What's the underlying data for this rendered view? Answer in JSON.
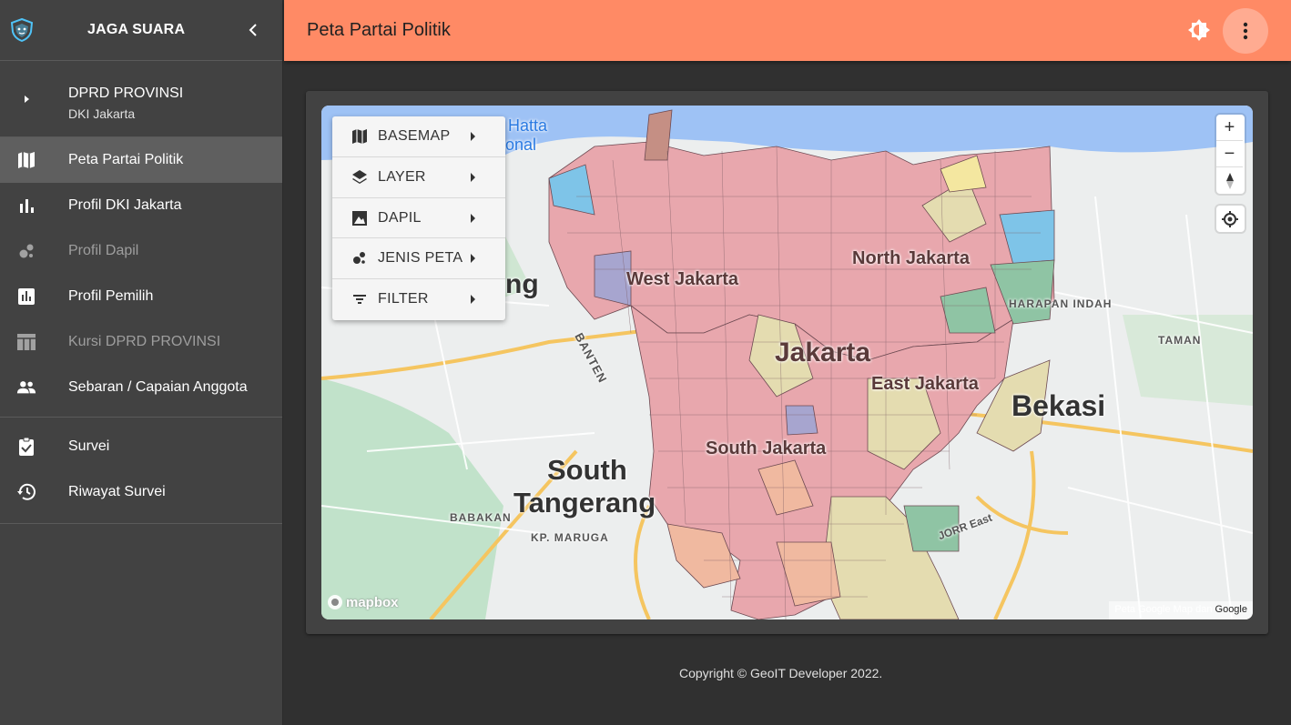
{
  "sidebar": {
    "brand": "JAGA SUARA",
    "section": {
      "title": "DPRD PROVINSI",
      "subtitle": "DKI Jakarta"
    },
    "items": [
      {
        "label": "Peta Partai Politik",
        "icon": "map-icon",
        "active": true
      },
      {
        "label": "Profil DKI Jakarta",
        "icon": "bar-chart-icon"
      },
      {
        "label": "Profil Dapil",
        "icon": "bubble-chart-icon",
        "disabled": true
      },
      {
        "label": "Profil Pemilih",
        "icon": "poll-icon"
      },
      {
        "label": "Kursi DPRD PROVINSI",
        "icon": "table-icon",
        "disabled": true
      },
      {
        "label": "Sebaran / Capaian Anggota",
        "icon": "people-icon"
      }
    ],
    "items2": [
      {
        "label": "Survei",
        "icon": "clipboard-check-icon"
      },
      {
        "label": "Riwayat Survei",
        "icon": "history-icon"
      }
    ]
  },
  "topbar": {
    "title": "Peta Partai Politik"
  },
  "map_menu": [
    {
      "label": "BASEMAP",
      "icon": "map-icon"
    },
    {
      "label": "LAYER",
      "icon": "layers-icon"
    },
    {
      "label": "DAPIL",
      "icon": "image-icon"
    },
    {
      "label": "JENIS PETA",
      "icon": "bubble-chart-icon"
    },
    {
      "label": "FILTER",
      "icon": "filter-icon"
    }
  ],
  "map": {
    "labels": {
      "west_jakarta": "West Jakarta",
      "north_jakarta": "North Jakarta",
      "jakarta": "Jakarta",
      "east_jakarta": "East Jakarta",
      "south_jakarta": "South Jakarta",
      "bekasi": "Bekasi",
      "south": "South",
      "tangerang": "Tangerang",
      "banten": "BANTEN",
      "babakan": "BABAKAN",
      "kp_maruga": "KP. MARUGA",
      "taman": "TAMAN",
      "harapan_indah": "HARAPAN INDAH",
      "hatta": "Hatta",
      "onal": "onal",
      "ng": "ng",
      "jorr_east": "JORR East"
    },
    "attribution": {
      "left": "Peta Google Map dan",
      "right": "Google"
    },
    "mapbox": "mapbox",
    "colors": {
      "pdip": "#e8a7ad",
      "pks": "#e4dcb0",
      "gerindra": "#f0b9a0",
      "demokrat": "#7ec4e8",
      "pkb": "#8fc4a4"
    }
  },
  "footer": "Copyright © GeoIT Developer 2022."
}
